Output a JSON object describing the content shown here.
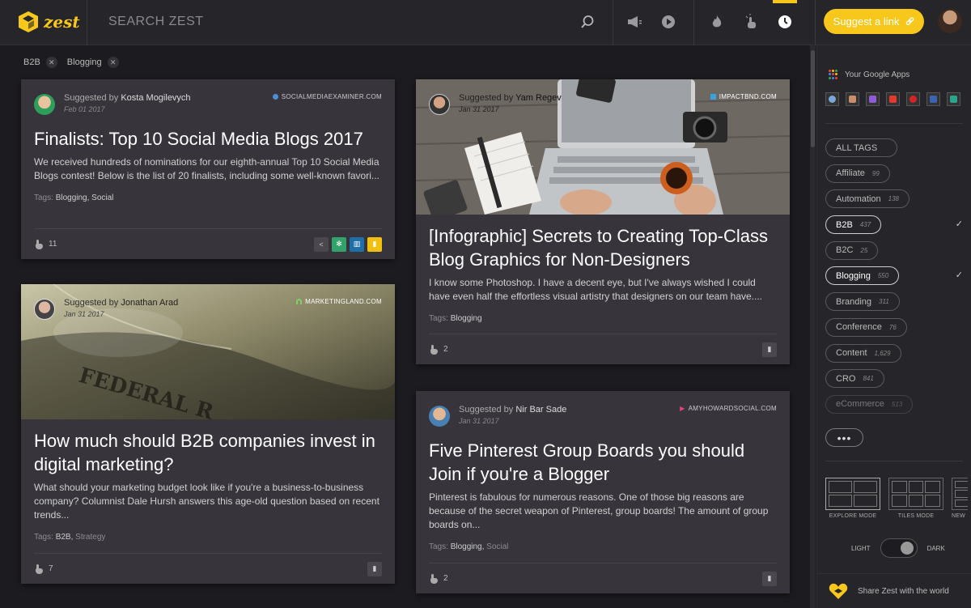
{
  "app": {
    "logo_text": "zest",
    "search_placeholder": "SEARCH ZEST",
    "suggest_label": "Suggest a link"
  },
  "toolbar_icons": [
    "search-icon",
    "megaphone-icon",
    "play-icon",
    "flame-icon",
    "clap-icon",
    "clock-icon"
  ],
  "filters": [
    {
      "label": "B2B"
    },
    {
      "label": "Blogging"
    }
  ],
  "cards": [
    {
      "suggested_prefix": "Suggested by",
      "author": "Kosta Mogilevych",
      "date": "Feb 01 2017",
      "source": "SOCIALMEDIAEXAMINER.COM",
      "title": "Finalists: Top 10 Social Media Blogs 2017",
      "description": "We received hundreds of nominations for our eighth-annual Top 10 Social Media Blogs contest! Below is the list of 20 finalists, including some well-known favori...",
      "tags_label": "Tags:",
      "tag1": "Blogging,",
      "tag2": "Social",
      "claps": "11"
    },
    {
      "suggested_prefix": "Suggested by",
      "author": "Yam Regev",
      "date": "Jan 31 2017",
      "source": "IMPACTBND.COM",
      "title": "[Infographic] Secrets to Creating Top-Class Blog Graphics for Non-Designers",
      "description": "I know some Photoshop. I have a decent eye, but I've always wished I could have even half the effortless visual artistry that designers on our team have....",
      "tags_label": "Tags:",
      "tag1": "Blogging",
      "tag2": "",
      "claps": "2"
    },
    {
      "suggested_prefix": "Suggested by",
      "author": "Jonathan Arad",
      "date": "Jan 31 2017",
      "source": "MARKETINGLAND.COM",
      "title": "How much should B2B companies invest in digital marketing?",
      "description": "What should your marketing budget look like if you're a business-to-business company? Columnist Dale Hursh answers this age-old question based on recent trends...",
      "tags_label": "Tags:",
      "tag1": "B2B,",
      "tag2": "Strategy",
      "claps": "7"
    },
    {
      "suggested_prefix": "Suggested by",
      "author": "Nir Bar Sade",
      "date": "Jan 31 2017",
      "source": "AMYHOWARDSOCIAL.COM",
      "title": "Five Pinterest Group Boards you should Join if you're a Blogger",
      "description": "Pinterest is fabulous for numerous reasons. One of those big reasons are because of the secret weapon of Pinterest, group boards! The amount of group boards on...",
      "tags_label": "Tags:",
      "tag1": "Blogging,",
      "tag2": "Social",
      "claps": "2"
    }
  ],
  "sidebar": {
    "google_apps_title": "Your Google Apps",
    "tags": [
      {
        "name": "ALL TAGS",
        "count": "",
        "selected": false
      },
      {
        "name": "Affiliate",
        "count": "99",
        "selected": false
      },
      {
        "name": "Automation",
        "count": "138",
        "selected": false
      },
      {
        "name": "B2B",
        "count": "437",
        "selected": true
      },
      {
        "name": "B2C",
        "count": "25",
        "selected": false
      },
      {
        "name": "Blogging",
        "count": "550",
        "selected": true
      },
      {
        "name": "Branding",
        "count": "311",
        "selected": false
      },
      {
        "name": "Conference",
        "count": "76",
        "selected": false
      },
      {
        "name": "Content",
        "count": "1,629",
        "selected": false
      },
      {
        "name": "CRO",
        "count": "841",
        "selected": false
      },
      {
        "name": "eCommerce",
        "count": "513",
        "selected": false
      }
    ],
    "more_label": "•••",
    "modes": [
      {
        "label": "EXPLORE MODE"
      },
      {
        "label": "TILES MODE"
      },
      {
        "label": "NEW"
      }
    ],
    "light_label": "LIGHT",
    "dark_label": "DARK",
    "share_label": "Share Zest with the world",
    "check_mark": "✓"
  },
  "colors": {
    "accent": "#f7c81b",
    "background": "#1c1b1f",
    "card": "#37353b"
  }
}
